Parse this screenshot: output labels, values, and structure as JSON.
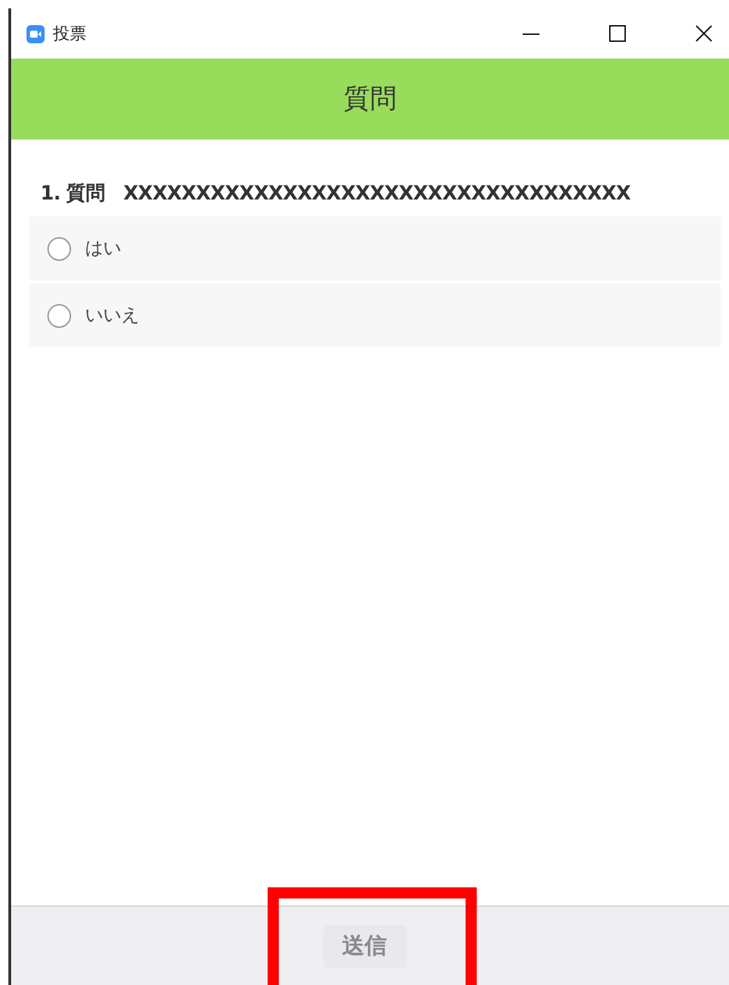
{
  "window": {
    "title": "投票"
  },
  "header": {
    "title": "質問"
  },
  "question": {
    "number": "1.",
    "label": "質問",
    "text": "XXXXXXXXXXXXXXXXXXXXXXXXXXXXXXXXXXX"
  },
  "options": [
    {
      "label": "はい",
      "selected": false
    },
    {
      "label": "いいえ",
      "selected": false
    }
  ],
  "submit": {
    "label": "送信",
    "disabled": true,
    "highlighted": true
  }
}
